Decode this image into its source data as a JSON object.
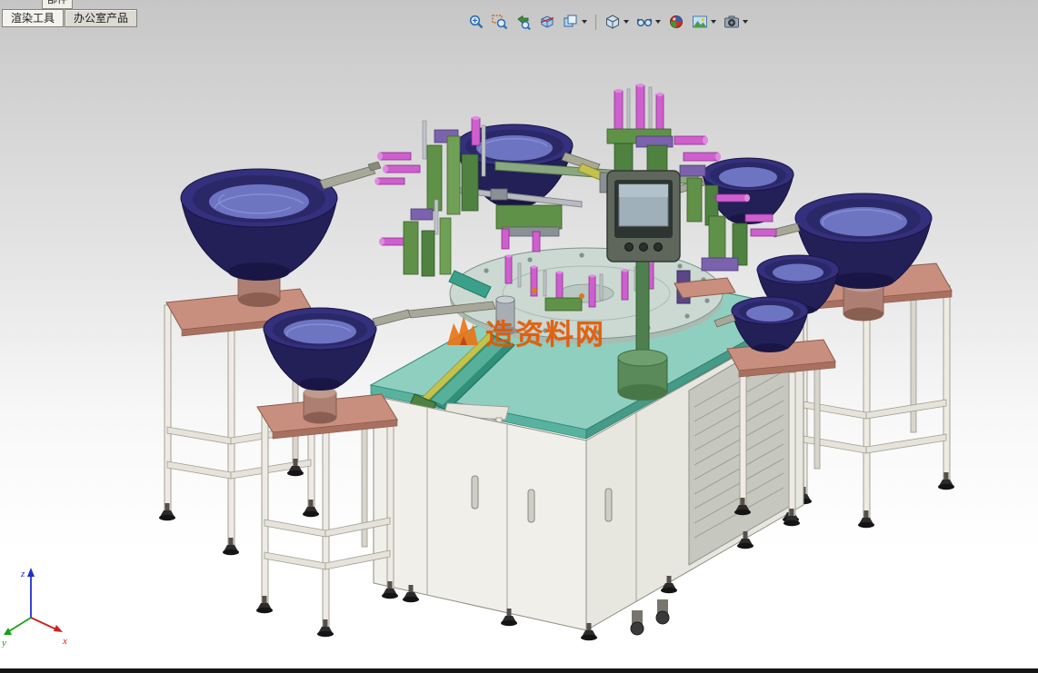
{
  "command_tabs": {
    "clipped_tab_label": "部件",
    "tabs": [
      {
        "label": "渲染工具",
        "active": true
      },
      {
        "label": "办公室产品",
        "active": false
      }
    ]
  },
  "headsup_toolbar": {
    "buttons": [
      {
        "name": "zoom-to-fit",
        "dropdown": false
      },
      {
        "name": "zoom-to-area",
        "dropdown": false
      },
      {
        "name": "previous-view",
        "dropdown": false
      },
      {
        "name": "section-view",
        "dropdown": false
      },
      {
        "name": "view-orientation",
        "dropdown": true
      },
      {
        "name": "display-style",
        "dropdown": true
      },
      {
        "name": "hide-show-items",
        "dropdown": true
      },
      {
        "name": "edit-appearance",
        "dropdown": false
      },
      {
        "name": "apply-scene",
        "dropdown": true
      },
      {
        "name": "view-settings",
        "dropdown": true
      }
    ]
  },
  "viewport": {
    "watermark": {
      "text": "造资料网",
      "color": "#e25800",
      "logo": "flame-logo"
    },
    "triad": {
      "x_label": "x",
      "y_label": "y",
      "z_label": "z"
    },
    "model": {
      "name": "rotary-assembly-machine",
      "parts": [
        "vibratory-bowl-feeder-left-large",
        "vibratory-bowl-feeder-left-front",
        "vibratory-bowl-feeder-top",
        "vibratory-bowl-feeder-top-right",
        "vibratory-bowl-feeder-right-large",
        "vibratory-bowl-feeder-right-small-pair",
        "rotary-index-plate",
        "machine-table",
        "machine-cabinet",
        "hmi-control-panel",
        "tooling-fixtures",
        "discharge-chute",
        "feeder-stands"
      ],
      "colors": {
        "bowl": "#2b2a6e",
        "bowl_interior": "#6d74c2",
        "table_top": "#8fcfc0",
        "stand_plate": "#c98f7e",
        "cabinet": "#f0efe9",
        "fixture_green": "#5f9148",
        "fixture_magenta": "#cf5fcf",
        "pole_green": "#4f7f4f"
      }
    },
    "background": {
      "top": "#c6c6c6",
      "bottom": "#ffffff"
    }
  },
  "status_bar": {
    "color": "#161616"
  }
}
